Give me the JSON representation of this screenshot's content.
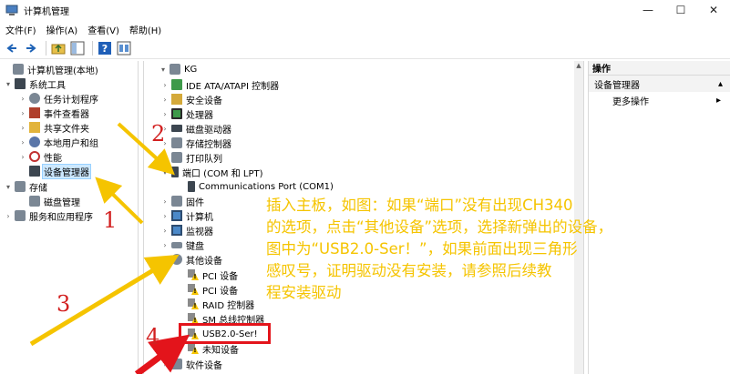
{
  "window": {
    "title": "计算机管理",
    "controls": {
      "minimize": "—",
      "maximize": "☐",
      "close": "✕"
    }
  },
  "menu": [
    "文件(F)",
    "操作(A)",
    "查看(V)",
    "帮助(H)"
  ],
  "left_tree": [
    {
      "label": "计算机管理(本地)",
      "twisty": "",
      "icon": "computer"
    },
    {
      "label": "系统工具",
      "twisty": "▾",
      "icon": "tools"
    },
    {
      "label": "任务计划程序",
      "twisty": "›",
      "icon": "clock"
    },
    {
      "label": "事件查看器",
      "twisty": "›",
      "icon": "event"
    },
    {
      "label": "共享文件夹",
      "twisty": "›",
      "icon": "folder"
    },
    {
      "label": "本地用户和组",
      "twisty": "›",
      "icon": "users"
    },
    {
      "label": "性能",
      "twisty": "›",
      "icon": "performance"
    },
    {
      "label": "设备管理器",
      "twisty": "",
      "icon": "device-manager",
      "selected": true
    },
    {
      "label": "存储",
      "twisty": "▾",
      "icon": "storage"
    },
    {
      "label": "磁盘管理",
      "twisty": "",
      "icon": "disk"
    },
    {
      "label": "服务和应用程序",
      "twisty": "›",
      "icon": "services"
    }
  ],
  "device_tree": [
    {
      "label": "KG",
      "twisty": "▾",
      "icon": "computer"
    },
    {
      "label": "IDE ATA/ATAPI 控制器",
      "twisty": "›",
      "icon": "ide"
    },
    {
      "label": "安全设备",
      "twisty": "›",
      "icon": "security"
    },
    {
      "label": "处理器",
      "twisty": "›",
      "icon": "cpu"
    },
    {
      "label": "磁盘驱动器",
      "twisty": "›",
      "icon": "disk"
    },
    {
      "label": "存储控制器",
      "twisty": "›",
      "icon": "storage-ctrl"
    },
    {
      "label": "打印队列",
      "twisty": "›",
      "icon": "printer"
    },
    {
      "label": "端口 (COM 和 LPT)",
      "twisty": "▾",
      "icon": "port"
    },
    {
      "label": "Communications Port (COM1)",
      "twisty": "",
      "icon": "port"
    },
    {
      "label": "固件",
      "twisty": "›",
      "icon": "firmware"
    },
    {
      "label": "计算机",
      "twisty": "›",
      "icon": "computer"
    },
    {
      "label": "监视器",
      "twisty": "›",
      "icon": "monitor"
    },
    {
      "label": "键盘",
      "twisty": "›",
      "icon": "keyboard"
    },
    {
      "label": "其他设备",
      "twisty": "▾",
      "icon": "other"
    },
    {
      "label": "PCI 设备",
      "twisty": "",
      "icon": "warning"
    },
    {
      "label": "PCI 设备",
      "twisty": "",
      "icon": "warning"
    },
    {
      "label": "RAID 控制器",
      "twisty": "",
      "icon": "warning"
    },
    {
      "label": "SM 总线控制器",
      "twisty": "",
      "icon": "warning"
    },
    {
      "label": "USB2.0-Ser!",
      "twisty": "",
      "icon": "warning"
    },
    {
      "label": "未知设备",
      "twisty": "",
      "icon": "warning"
    },
    {
      "label": "软件设备",
      "twisty": "›",
      "icon": "software"
    }
  ],
  "actions": {
    "header": "操作",
    "section": "设备管理器",
    "section_chevron": "▴",
    "more": "更多操作",
    "more_chevron": "▸"
  },
  "annotation": {
    "lines": [
      "插入主板，如图：如果“端口”没有出现CH340",
      "的选项，点击“其他设备”选项，选择新弹出的设备，",
      "图中为“USB2.0-Ser！”，如果前面出现三角形",
      "感叹号，证明驱动没有安装，请参照后续教",
      "程安装驱动"
    ],
    "numbers": [
      "1",
      "2",
      "3",
      "4"
    ],
    "colors": {
      "text": "#f5c400",
      "arrow": "#f5c400",
      "highlight": "#e3141b",
      "number": "#d22020"
    }
  }
}
